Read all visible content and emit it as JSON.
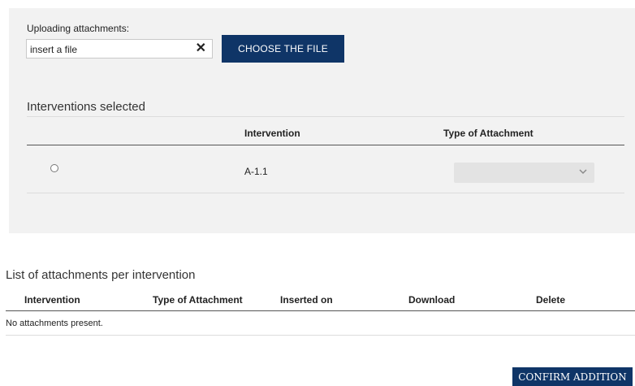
{
  "upload": {
    "label": "Uploading attachments:",
    "input_value": "insert a file",
    "clear_symbol": "✕",
    "choose_button": "CHOOSE THE FILE"
  },
  "interventions": {
    "title": "Interventions selected",
    "columns": [
      "Intervention",
      "Type of Attachment"
    ],
    "rows": [
      {
        "selected": false,
        "intervention": "A-1.1",
        "type_of_attachment": ""
      }
    ]
  },
  "attachments_list": {
    "title": "List of attachments per intervention",
    "columns": [
      "Intervention",
      "Type of Attachment",
      "Inserted on",
      "Download",
      "Delete"
    ],
    "empty_message": "No attachments present."
  },
  "confirm_button": "CONFIRM ADDITION",
  "colors": {
    "primary_button": "#0f3567",
    "panel_background": "#f2f2f2"
  }
}
